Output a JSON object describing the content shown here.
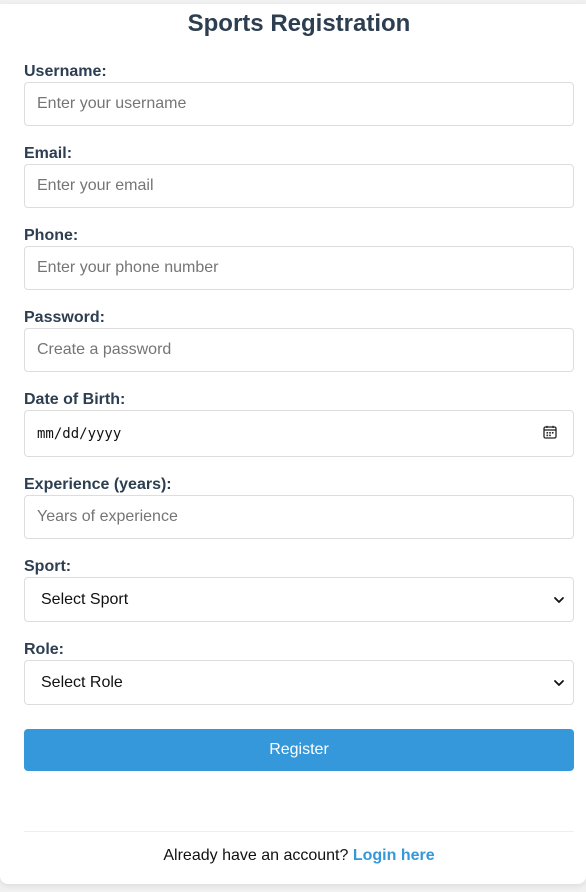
{
  "title": "Sports Registration",
  "fields": {
    "username": {
      "label": "Username:",
      "placeholder": "Enter your username"
    },
    "email": {
      "label": "Email:",
      "placeholder": "Enter your email"
    },
    "phone": {
      "label": "Phone:",
      "placeholder": "Enter your phone number"
    },
    "password": {
      "label": "Password:",
      "placeholder": "Create a password"
    },
    "dob": {
      "label": "Date of Birth:",
      "value": "mm/dd/yyyy",
      "icon": "calendar-icon"
    },
    "experience": {
      "label": "Experience (years):",
      "placeholder": "Years of experience"
    },
    "sport": {
      "label": "Sport:",
      "selected": "Select Sport",
      "icon": "chevron-down-icon"
    },
    "role": {
      "label": "Role:",
      "selected": "Select Role",
      "icon": "chevron-down-icon"
    }
  },
  "register_label": "Register",
  "footer": {
    "text": "Already have an account?",
    "link": "Login here"
  },
  "colors": {
    "accent": "#3498db",
    "heading": "#2c3e50",
    "border": "#dddddd"
  }
}
